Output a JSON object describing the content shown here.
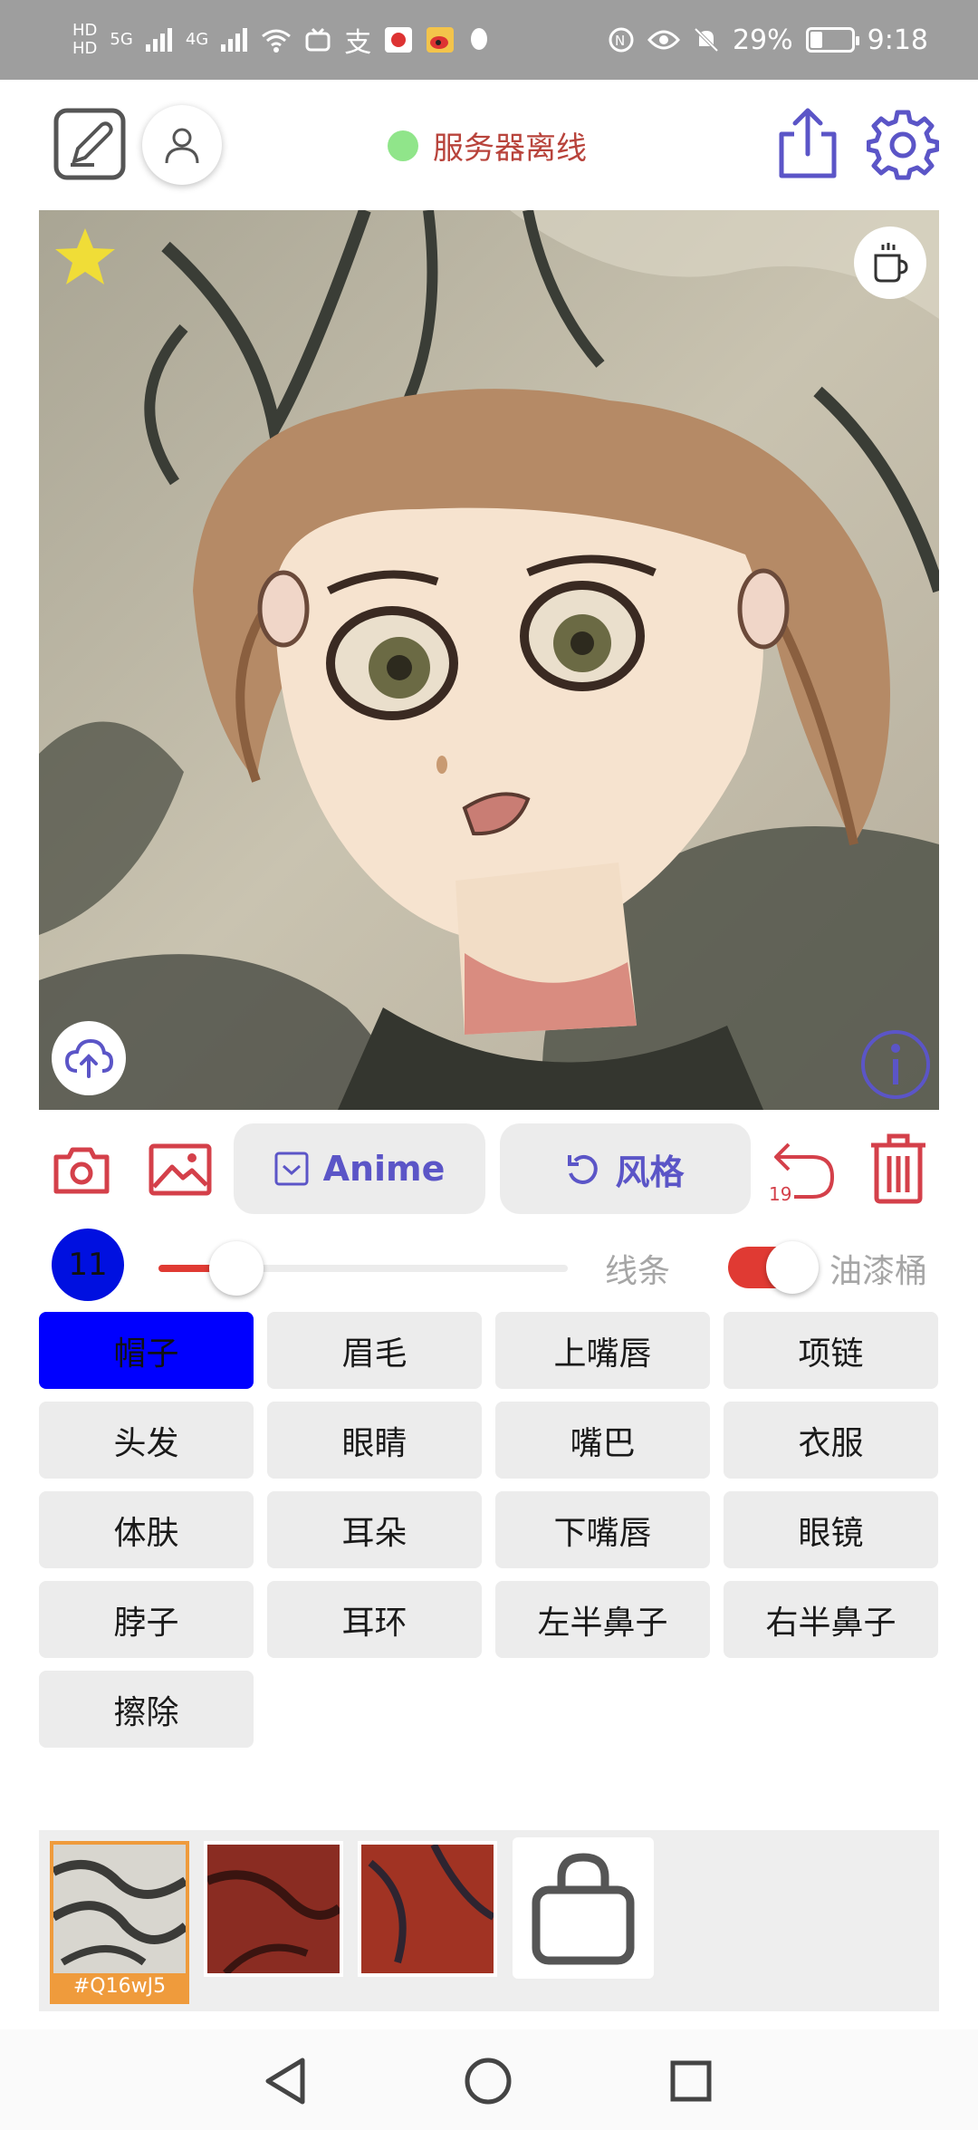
{
  "status_bar": {
    "left_small_1": "HD",
    "left_small_2": "HD",
    "signal_1": "5G",
    "signal_2": "4G",
    "app_glyph": "支",
    "battery": "29%",
    "time": "9:18",
    "battery_level": 0.29
  },
  "header": {
    "server_status": "服务器离线",
    "status_color": "#90e58a"
  },
  "toolbar": {
    "anime_label": "Anime",
    "style_label": "风格",
    "undo_count": "19"
  },
  "brush": {
    "size": "11",
    "slider_level": 0.19,
    "line_label": "线条",
    "bucket_label": "油漆桶",
    "bucket_on": true
  },
  "parts": [
    "帽子",
    "眉毛",
    "上嘴唇",
    "项链",
    "头发",
    "眼睛",
    "嘴巴",
    "衣服",
    "体肤",
    "耳朵",
    "下嘴唇",
    "眼镜",
    "脖子",
    "耳环",
    "左半鼻子",
    "右半鼻子",
    "擦除"
  ],
  "styles": {
    "selected_label": "#Q16wJ5"
  },
  "colors": {
    "accent": "#5b55c7",
    "danger": "#d4404a",
    "selected_part": "#0000ff",
    "selected_style": "#ef9b3c"
  }
}
